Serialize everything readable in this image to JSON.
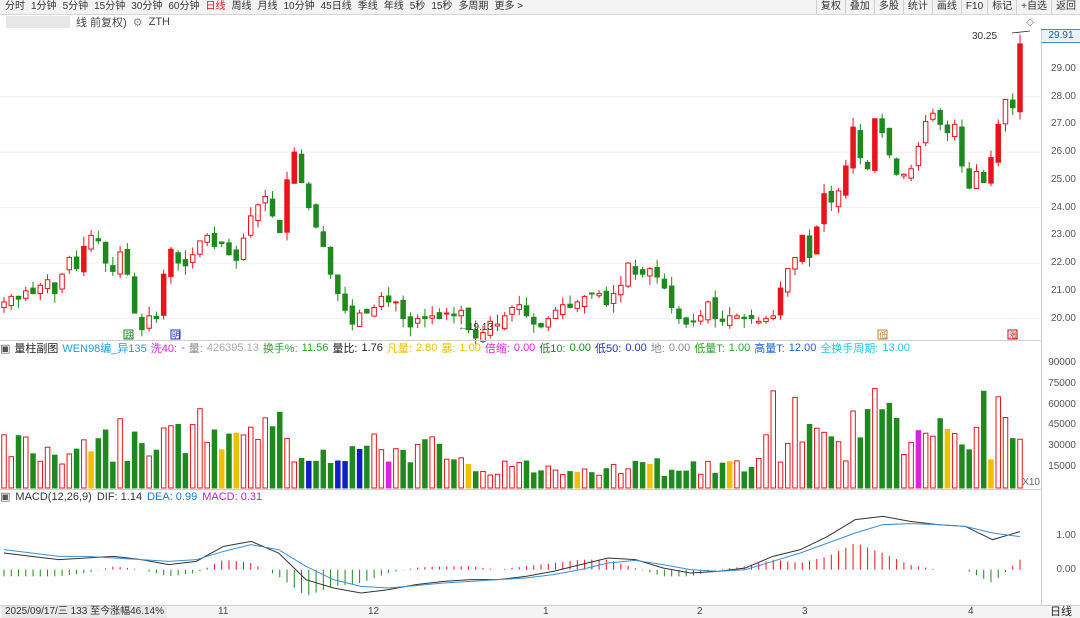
{
  "toolbar": {
    "periods": [
      "分时",
      "1分钟",
      "5分钟",
      "15分钟",
      "30分钟",
      "60分钟",
      "日线",
      "周线",
      "月线",
      "10分钟",
      "45日线",
      "季线",
      "年线",
      "5秒",
      "15秒",
      "多周期",
      "更多 >"
    ],
    "active_period": "日线",
    "right_buttons": [
      "复权",
      "叠加",
      "多股",
      "统计",
      "画线",
      "F10",
      "标记",
      "+自选",
      "返回"
    ]
  },
  "main_header": {
    "adjust_label": "线 前复权)",
    "indicator": "ZTH"
  },
  "price_axis": {
    "labels": [
      "29.00",
      "28.00",
      "27.00",
      "26.00",
      "25.00",
      "24.00",
      "23.00",
      "22.00",
      "21.00",
      "20.00"
    ],
    "current_price": "29.91",
    "high_label": "30.25",
    "low_label": "←19.13"
  },
  "volume_panel": {
    "title": "量柱副图",
    "legend": [
      {
        "text": "WEN98编_异135",
        "color": "#1aa0d8"
      },
      {
        "text": "洗40:",
        "color": "#e020e0"
      },
      {
        "text": "-",
        "color": "#e020e0"
      },
      {
        "text": "量:",
        "color": "#888888"
      },
      {
        "text": "426395.13",
        "color": "#aaaaaa"
      },
      {
        "text": "换手%:",
        "color": "#2aa22a"
      },
      {
        "text": "11.56",
        "color": "#2aa22a"
      },
      {
        "text": "量比:",
        "color": "#222222"
      },
      {
        "text": "1.76",
        "color": "#222222"
      },
      {
        "text": "凡量:",
        "color": "#e8c000"
      },
      {
        "text": "2.80",
        "color": "#e8c000"
      },
      {
        "text": "暴:",
        "color": "#e8c000"
      },
      {
        "text": "1.00",
        "color": "#e8c000"
      },
      {
        "text": "倍缩:",
        "color": "#e020e0"
      },
      {
        "text": "0.00",
        "color": "#e020e0"
      },
      {
        "text": "低10:",
        "color": "#1a8a1a"
      },
      {
        "text": "0.00",
        "color": "#1a8a1a"
      },
      {
        "text": "低50:",
        "color": "#2030c0"
      },
      {
        "text": "0.00",
        "color": "#2030c0"
      },
      {
        "text": "地:",
        "color": "#888888"
      },
      {
        "text": "0.00",
        "color": "#888888"
      },
      {
        "text": "低量T:",
        "color": "#2aa22a"
      },
      {
        "text": "1.00",
        "color": "#2aa22a"
      },
      {
        "text": "高量T:",
        "color": "#2060d0"
      },
      {
        "text": "12.00",
        "color": "#2060d0"
      },
      {
        "text": "全换手周期:",
        "color": "#20c8e8"
      },
      {
        "text": "13.00",
        "color": "#20c8e8"
      }
    ],
    "axis_labels": [
      "90000",
      "75000",
      "60000",
      "45000",
      "30000",
      "15000"
    ],
    "unit": "X10"
  },
  "macd_panel": {
    "legend": [
      {
        "text": "MACD(12,26,9)",
        "color": "#333333"
      },
      {
        "text": "DIF: 1.14",
        "color": "#333333"
      },
      {
        "text": "DEA: 0.99",
        "color": "#1a78c8"
      },
      {
        "text": "MACD: 0.31",
        "color": "#c020c0"
      }
    ],
    "axis_labels": [
      "1.00",
      "0.00"
    ]
  },
  "bottom_bar": {
    "date_info": "2025/09/17/三 133 至今涨幅46.14%",
    "months": [
      "11",
      "12",
      "1",
      "2",
      "3",
      "4"
    ],
    "period_type": "日线"
  },
  "markers": [
    {
      "label": "跌",
      "color": "#1a8a1a"
    },
    {
      "label": "明",
      "color": "#2030c0"
    },
    {
      "label": "低",
      "color": "#c08030"
    },
    {
      "label": "涨",
      "color": "#c01010"
    }
  ],
  "colors": {
    "up": "#e8141c",
    "down": "#1e8a1e",
    "dif": "#333333",
    "dea": "#3a8fd8"
  },
  "chart_data": {
    "type": "candlestick",
    "ylim": [
      19.3,
      30.4
    ],
    "closes": [
      20.6,
      20.8,
      20.7,
      21.0,
      20.9,
      21.2,
      21.4,
      20.9,
      21.6,
      22.2,
      21.8,
      22.6,
      23.0,
      22.8,
      22.0,
      21.7,
      22.4,
      21.6,
      20.2,
      19.6,
      20.1,
      20.0,
      21.6,
      22.5,
      22.0,
      21.9,
      22.3,
      22.8,
      23.0,
      22.6,
      22.7,
      22.3,
      22.1,
      22.9,
      23.7,
      24.1,
      24.4,
      23.7,
      23.1,
      25.0,
      26.0,
      24.9,
      24.0,
      23.3,
      22.6,
      21.6,
      20.9,
      20.3,
      19.8,
      20.2,
      20.2,
      20.4,
      20.8,
      20.6,
      20.6,
      20.0,
      19.7,
      20.0,
      20.0,
      20.1,
      20.0,
      20.2,
      20.1,
      20.3,
      19.6,
      19.3,
      19.5,
      19.9,
      19.8,
      20.1,
      20.4,
      20.5,
      20.1,
      19.8,
      19.7,
      20.0,
      20.3,
      20.5,
      20.4,
      20.6,
      20.8,
      20.9,
      20.9,
      20.5,
      20.9,
      21.2,
      22.0,
      21.6,
      21.6,
      21.8,
      21.5,
      21.1,
      20.4,
      20.0,
      19.8,
      19.9,
      20.1,
      20.6,
      20.0,
      19.9,
      20.1,
      20.1,
      20.0,
      20.0,
      19.9,
      20.0,
      20.1,
      21.1,
      21.8,
      22.2,
      23.0,
      22.2,
      23.3,
      24.5,
      24.2,
      24.6,
      25.5,
      26.9,
      25.8,
      25.4,
      27.2,
      26.7,
      25.9,
      25.2,
      25.2,
      25.4,
      26.2,
      27.1,
      27.4,
      27.0,
      26.7,
      27.0,
      25.5,
      24.7,
      25.3,
      24.9,
      25.8,
      27.0,
      27.9,
      27.6,
      29.9
    ],
    "macd": {
      "dif": [
        0.5,
        0.4,
        0.3,
        0.35,
        0.4,
        0.3,
        0.15,
        0.25,
        0.7,
        0.85,
        0.5,
        -0.3,
        -0.55,
        -0.7,
        -0.6,
        -0.45,
        -0.35,
        -0.3,
        -0.3,
        -0.2,
        -0.05,
        0.15,
        0.35,
        0.3,
        0.05,
        -0.1,
        -0.05,
        0.05,
        0.4,
        0.6,
        1.0,
        1.5,
        1.6,
        1.45,
        1.35,
        1.3,
        0.9,
        1.14
      ],
      "dea": [
        0.6,
        0.5,
        0.4,
        0.4,
        0.35,
        0.3,
        0.25,
        0.3,
        0.55,
        0.75,
        0.6,
        0.1,
        -0.3,
        -0.5,
        -0.55,
        -0.48,
        -0.4,
        -0.35,
        -0.3,
        -0.25,
        -0.15,
        0.0,
        0.2,
        0.28,
        0.15,
        0.0,
        -0.05,
        0.0,
        0.25,
        0.5,
        0.8,
        1.1,
        1.35,
        1.38,
        1.35,
        1.3,
        1.1,
        0.99
      ]
    }
  }
}
